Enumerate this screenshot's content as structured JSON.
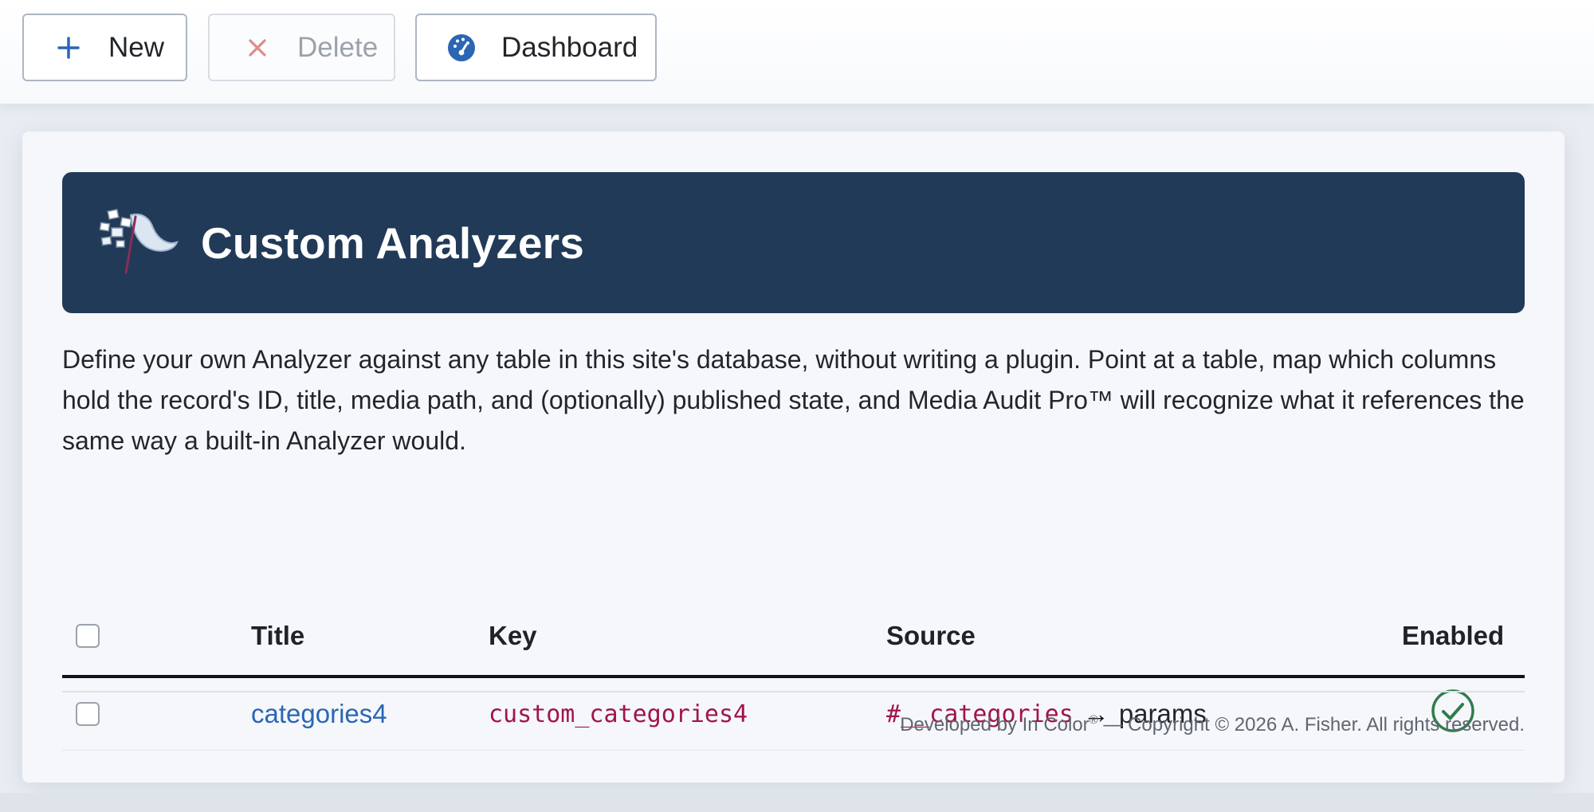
{
  "toolbar": {
    "new_label": "New",
    "delete_label": "Delete",
    "dashboard_label": "Dashboard"
  },
  "header": {
    "title": "Custom Analyzers"
  },
  "intro_text": "Define your own Analyzer against any table in this site's database, without writing a plugin. Point at a table, map which columns hold the record's ID, title, media path, and (optionally) published state, and Media Audit Pro™ will recognize what it references the same way a built-in Analyzer would.",
  "table": {
    "columns": [
      "Title",
      "Key",
      "Source",
      "Enabled"
    ],
    "rows": [
      {
        "title": "categories4",
        "key": "custom_categories4",
        "source_table": "#__categories",
        "source_arrow": "→",
        "source_column": "params",
        "enabled": true,
        "enabled_icon": "check-circle-icon"
      }
    ]
  },
  "footer": {
    "prefix": "Developed by In Color",
    "registered": "®",
    "suffix": " — Copyright © 2026 A. Fisher. All rights reserved."
  },
  "colors": {
    "banner": "#213a57",
    "link": "#2a66b3",
    "code": "#a0154a",
    "enabled": "#2f7d4a",
    "accent_icon": "#2a66b3",
    "delete_icon": "#e08a8a"
  }
}
